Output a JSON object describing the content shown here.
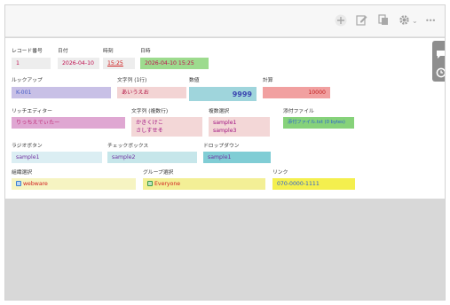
{
  "toolbar": {
    "icons": [
      "add-icon",
      "edit-icon",
      "copy-icon",
      "gear-icon",
      "more-icon"
    ],
    "more_label": "•••",
    "gear_dropdown": "⌄"
  },
  "side": {
    "icons": [
      "comment-icon",
      "history-icon"
    ]
  },
  "fields": {
    "record_number": {
      "label": "レコード番号",
      "value": "1"
    },
    "date": {
      "label": "日付",
      "value": "2026-04-10"
    },
    "time": {
      "label": "時刻",
      "value": "15:25"
    },
    "datetime": {
      "label": "日時",
      "value": "2026-04-10 15:25"
    },
    "lookup": {
      "label": "ルックアップ",
      "value": "K-001"
    },
    "text_single": {
      "label": "文字列 (1行)",
      "value": "あいうえお"
    },
    "number": {
      "label": "数値",
      "value": "9999"
    },
    "calc": {
      "label": "計算",
      "value": "10000"
    },
    "rich_editor": {
      "label": "リッチエディター",
      "value": "りっちえでぃたー"
    },
    "text_multi": {
      "label": "文字列 (複数行)",
      "line1": "かきくけこ",
      "line2": "さしすせそ"
    },
    "multi_select": {
      "label": "複数選択",
      "line1": "sample1",
      "line2": "sample3"
    },
    "attachment": {
      "label": "添付ファイル",
      "value": "添付ファイル.txt (0 bytes)"
    },
    "radio": {
      "label": "ラジオボタン",
      "value": "sample1"
    },
    "checkbox": {
      "label": "チェックボックス",
      "value": "sample2"
    },
    "dropdown": {
      "label": "ドロップダウン",
      "value": "sample1"
    },
    "org_select": {
      "label": "組織選択",
      "value": "webware"
    },
    "group_select": {
      "label": "グループ選択",
      "value": "Everyone"
    },
    "link": {
      "label": "リンク",
      "value": "070-0000-1111"
    }
  },
  "colors": {
    "lookup_bg": "#c8c0e6",
    "lookup_text": "#4a5fc8",
    "text_single_bg": "#f3d4d4",
    "number_bg": "#9fd5dc",
    "number_text": "#3a46b0",
    "calc_bg": "#f1a0a0",
    "calc_text": "#c02020",
    "rich_bg": "#dfa7d2",
    "rich_text": "#c0307a",
    "multi_bg": "#f3d7d7",
    "multi_text": "#a01080",
    "attach_bg": "#86d27a",
    "attach_text": "#2c60d0",
    "radio_bg": "#dbeef3",
    "checkbox_bg": "#c6e6ea",
    "dropdown_bg": "#80cdd5",
    "org_bg": "#f6f4c2",
    "group_bg": "#f3ef96",
    "link_bg": "#f4ef4e",
    "datetime_bg": "#9ddb8e",
    "record_bg": "#ededed",
    "date_bg": "#ededed",
    "time_bg": "#ededed"
  }
}
